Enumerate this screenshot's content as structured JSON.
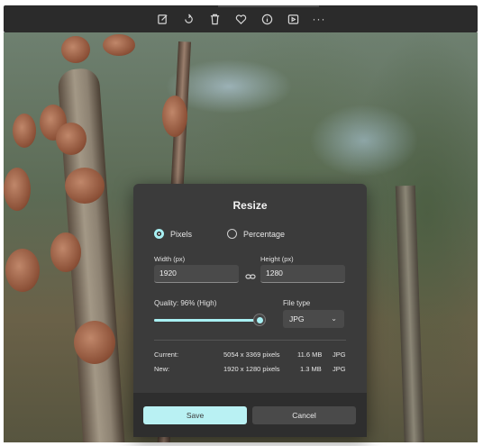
{
  "toolbar": {
    "items": [
      {
        "icon": "edit-icon"
      },
      {
        "icon": "rotate-icon"
      },
      {
        "icon": "delete-icon"
      },
      {
        "icon": "heart-icon"
      },
      {
        "icon": "info-icon"
      },
      {
        "icon": "slideshow-icon"
      },
      {
        "icon": "more-icon",
        "label": "···"
      }
    ]
  },
  "dialog": {
    "title": "Resize",
    "mode_pixels": "Pixels",
    "mode_percentage": "Percentage",
    "selected_mode": "Pixels",
    "width_label": "Width (px)",
    "width_value": "1920",
    "height_label": "Height (px)",
    "height_value": "1280",
    "quality_label": "Quality: 96% (High)",
    "quality_value": 96,
    "filetype_label": "File type",
    "filetype_value": "JPG",
    "current_label": "Current:",
    "current_pixels": "5054 x 3369 pixels",
    "current_size": "11.6 MB",
    "current_type": "JPG",
    "new_label": "New:",
    "new_pixels": "1920 x 1280 pixels",
    "new_size": "1.3 MB",
    "new_type": "JPG",
    "save_label": "Save",
    "cancel_label": "Cancel"
  },
  "colors": {
    "accent": "#a8f0f3",
    "dialog_bg": "#3b3b3b",
    "toolbar_bg": "#2b2b2b"
  }
}
